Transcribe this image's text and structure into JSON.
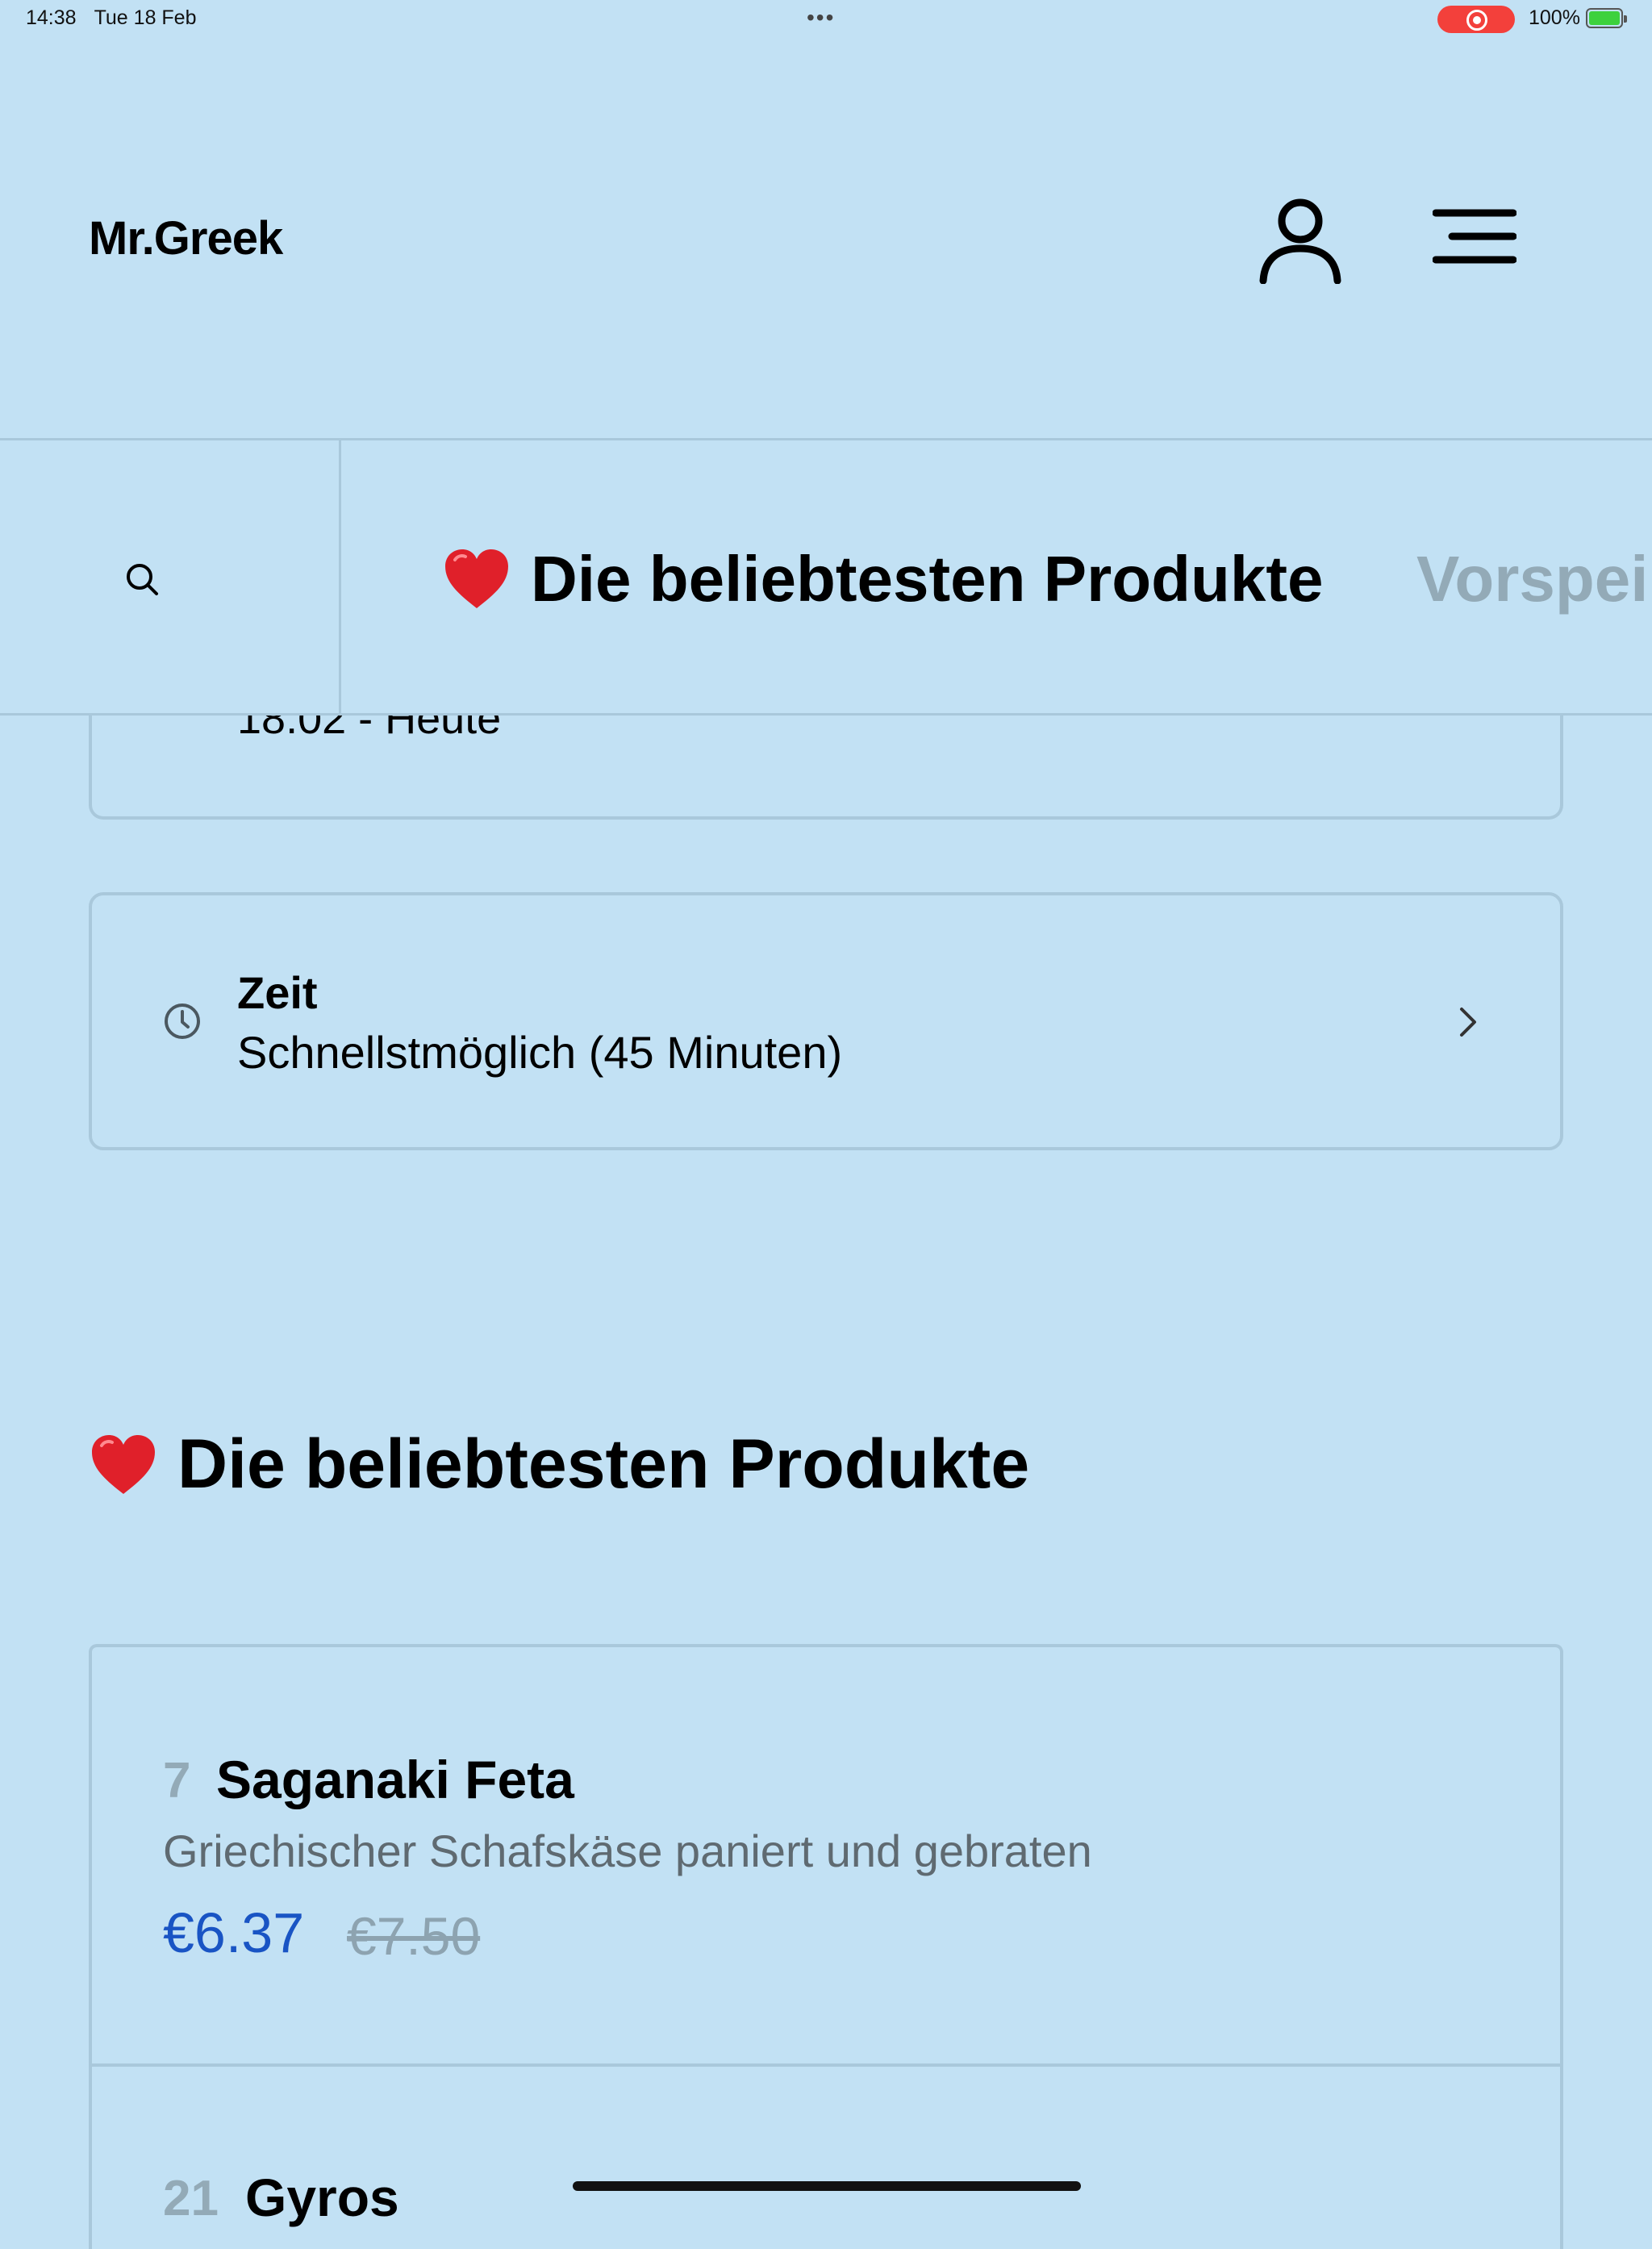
{
  "status_bar": {
    "time": "14:38",
    "date": "Tue 18 Feb",
    "battery": "100%",
    "dots": "•••"
  },
  "header": {
    "brand": "Mr.Greek"
  },
  "category_bar": {
    "active": "Die beliebtesten Produkte",
    "next": "Vorspei"
  },
  "delivery_date": {
    "value": "18.02 - Heute"
  },
  "time_option": {
    "title": "Zeit",
    "value": "Schnellstmöglich (45 Minuten)"
  },
  "section": {
    "title": "Die beliebtesten Produkte"
  },
  "products": [
    {
      "number": "7",
      "name": "Saganaki Feta",
      "description": "Griechischer Schafskäse paniert und gebraten",
      "price": "€6.37",
      "old_price": "€7.50"
    },
    {
      "number": "21",
      "name": "Gyros"
    }
  ],
  "colors": {
    "background": "#c2e1f4",
    "border": "#a9c8db",
    "price": "#1954c4",
    "muted": "#93aab7",
    "record": "#f3403b"
  }
}
